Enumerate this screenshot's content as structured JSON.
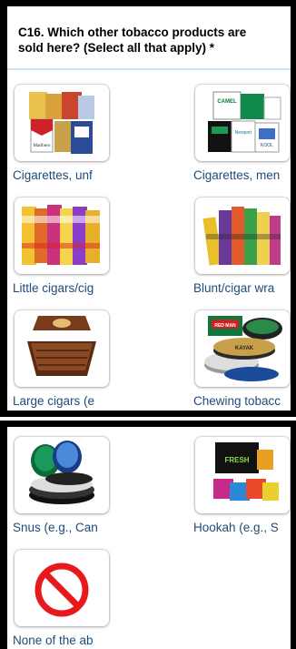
{
  "question": {
    "text": "C16. Which other tobacco products are sold here? (Select all that apply) *"
  },
  "options": [
    {
      "label": "Cigarettes, unf",
      "icon": "cigarette-packs-image"
    },
    {
      "label": "Cigarettes, men",
      "icon": "menthol-cigarette-packs-image"
    },
    {
      "label": "Little cigars/cig",
      "icon": "little-cigar-packs-image"
    },
    {
      "label": "Blunt/cigar wra",
      "icon": "blunt-wrap-packs-image"
    },
    {
      "label": "Large cigars (e",
      "icon": "cigar-box-image"
    },
    {
      "label": "Chewing tobacc",
      "icon": "chewing-tobacco-tins-image"
    },
    {
      "label": "Snus (e.g., Can",
      "icon": "snus-tins-image"
    },
    {
      "label": "Hookah (e.g., S",
      "icon": "hookah-tobacco-image"
    },
    {
      "label": "None of the ab",
      "icon": "prohibited-icon"
    }
  ],
  "brand_text": {
    "marlboro": "Marlboro",
    "camel": "CAMEL",
    "newport": "Newport",
    "kool": "KOOL",
    "red_man": "RED MAN",
    "kayak": "KAYAK",
    "fresh": "FRESH"
  },
  "colors": {
    "label": "#1f4a7a",
    "question_rule": "#cfe3f4",
    "prohibited_red": "#e8191d"
  }
}
